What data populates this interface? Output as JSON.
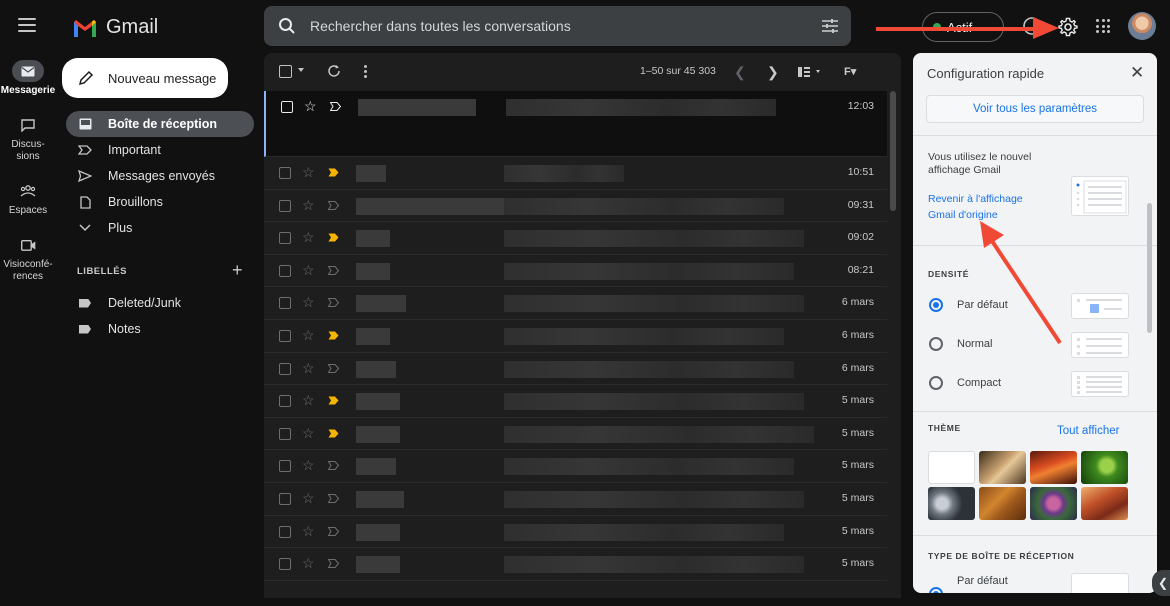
{
  "app": {
    "title": "Gmail"
  },
  "search": {
    "placeholder": "Rechercher dans toutes les conversations"
  },
  "header": {
    "status": "Actif"
  },
  "rail": [
    {
      "label": "Messagerie",
      "icon": "mail-icon",
      "active": true
    },
    {
      "label": "Discus-\nsions",
      "icon": "chat-icon"
    },
    {
      "label": "Espaces",
      "icon": "spaces-icon"
    },
    {
      "label": "Visioconfé-\nrences",
      "icon": "video-icon"
    }
  ],
  "compose": {
    "label": "Nouveau message"
  },
  "nav": [
    {
      "label": "Boîte de réception",
      "icon": "inbox-icon",
      "active": true
    },
    {
      "label": "Important",
      "icon": "important-icon"
    },
    {
      "label": "Messages envoyés",
      "icon": "send-icon"
    },
    {
      "label": "Brouillons",
      "icon": "draft-icon"
    },
    {
      "label": "Plus",
      "icon": "chevron-down-icon"
    }
  ],
  "labels": {
    "heading": "LIBELLÉS",
    "items": [
      {
        "label": "Deleted/Junk"
      },
      {
        "label": "Notes"
      }
    ]
  },
  "list": {
    "count": "1–50 sur 45 303",
    "rows": [
      {
        "date": "12:03",
        "important": false,
        "open": true
      },
      {
        "date": "10:51",
        "important": true
      },
      {
        "date": "09:31",
        "important": false
      },
      {
        "date": "09:02",
        "important": true
      },
      {
        "date": "08:21",
        "important": false
      },
      {
        "date": "6 mars",
        "important": false
      },
      {
        "date": "6 mars",
        "important": true
      },
      {
        "date": "6 mars",
        "important": false
      },
      {
        "date": "5 mars",
        "important": true
      },
      {
        "date": "5 mars",
        "important": true
      },
      {
        "date": "5 mars",
        "important": false
      },
      {
        "date": "5 mars",
        "important": false
      },
      {
        "date": "5 mars",
        "important": false
      },
      {
        "date": "5 mars",
        "important": false
      }
    ]
  },
  "quick_settings": {
    "title": "Configuration rapide",
    "all_settings": "Voir tous les paramètres",
    "new_view_text": "Vous utilisez le nouvel affichage Gmail",
    "revert_link": "Revenir à l'affichage Gmail d'origine",
    "density_heading": "DENSITÉ",
    "density_options": [
      {
        "label": "Par défaut",
        "selected": true
      },
      {
        "label": "Normal",
        "selected": false
      },
      {
        "label": "Compact",
        "selected": false
      }
    ],
    "theme_heading": "THÈME",
    "theme_show_all": "Tout afficher",
    "inbox_type_heading": "TYPE DE BOÎTE DE RÉCEPTION",
    "inbox_type_option": "Par défaut"
  },
  "colors": {
    "accent": "#1a73e8",
    "annotation": "#f04a37",
    "important": "#f5b400"
  }
}
